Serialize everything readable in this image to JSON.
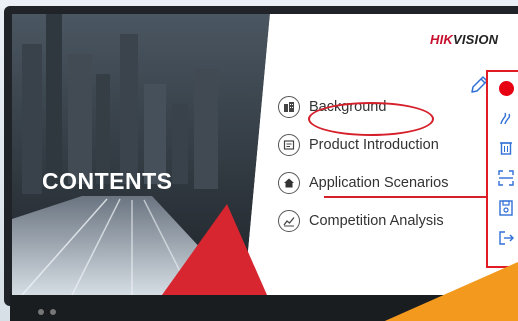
{
  "slide": {
    "title": "CONTENTS",
    "logo": {
      "brand_red": "HIK",
      "brand_dark": "VISION"
    },
    "items": [
      {
        "icon": "building-icon",
        "label": "Background"
      },
      {
        "icon": "document-icon",
        "label": "Product Introduction"
      },
      {
        "icon": "home-icon",
        "label": "Application Scenarios"
      },
      {
        "icon": "chart-icon",
        "label": "Competition Analysis"
      }
    ]
  },
  "annotation_toolbar": {
    "tools": [
      "record-icon",
      "pen-icon",
      "trash-icon",
      "screenshot-icon",
      "save-icon",
      "exit-icon"
    ]
  },
  "colors": {
    "ink_red": "#d51f2a",
    "toolbar_icon_blue": "#2f6fd6",
    "logo_red": "#c8102e",
    "orange_sweep": "#f39a1e"
  }
}
